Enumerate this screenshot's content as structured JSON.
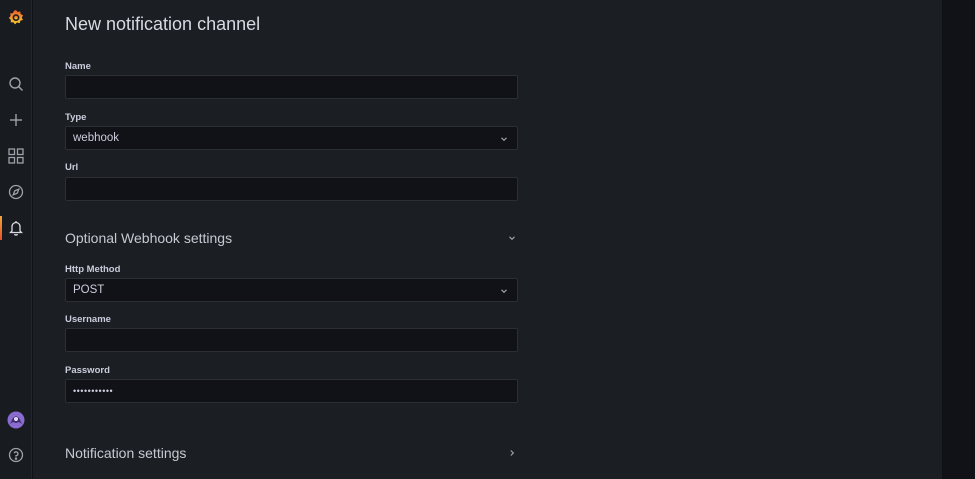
{
  "page": {
    "title": "New notification channel"
  },
  "sidebar": {
    "items": [
      {
        "icon": "grafana-logo-icon"
      },
      {
        "icon": "search-icon"
      },
      {
        "icon": "plus-icon"
      },
      {
        "icon": "dashboards-icon"
      },
      {
        "icon": "compass-icon"
      },
      {
        "icon": "bell-icon",
        "active": true
      },
      {
        "icon": "avatar"
      },
      {
        "icon": "help-icon"
      }
    ]
  },
  "form": {
    "name_label": "Name",
    "name_value": "",
    "type_label": "Type",
    "type_value": "webhook",
    "url_label": "Url",
    "url_value": ""
  },
  "webhook": {
    "section_title": "Optional Webhook settings",
    "http_method_label": "Http Method",
    "http_method_value": "POST",
    "username_label": "Username",
    "username_value": "",
    "password_label": "Password",
    "password_value": "•••••••••••"
  },
  "notification": {
    "section_title": "Notification settings"
  },
  "colors": {
    "accent": "#f2a53b",
    "sidebar_bg": "#181b1f",
    "main_bg": "#1b1e23",
    "input_bg": "#111217"
  }
}
